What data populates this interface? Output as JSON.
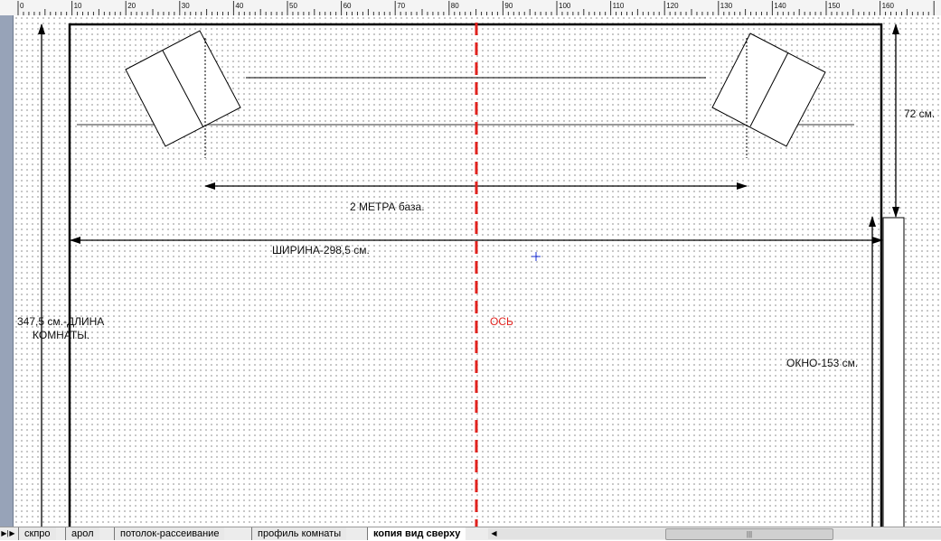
{
  "ruler": {
    "ticks": [
      "0",
      "10",
      "20",
      "30",
      "40",
      "50",
      "60",
      "70",
      "80",
      "90",
      "100",
      "110",
      "120",
      "130",
      "140",
      "150",
      "160"
    ]
  },
  "labels": {
    "base": "2 МЕТРА база.",
    "width": "ШИРИНА-298,5 см.",
    "length_line1": "347,5 см.-ДЛИНА",
    "length_line2": "КОМНАТЫ.",
    "axis": "ОСЬ",
    "offset": "72 см.",
    "window": "ОКНО-153 см."
  },
  "colors": {
    "axis": "#e0221e",
    "sidebar": "#97a3b8"
  },
  "tabs": [
    {
      "label": "скпро",
      "active": false
    },
    {
      "label": "арол",
      "active": false
    },
    {
      "label": "потолок-рассеивание",
      "active": false
    },
    {
      "label": "профиль комнаты",
      "active": false
    },
    {
      "label": "копия вид сверху",
      "active": true
    }
  ]
}
